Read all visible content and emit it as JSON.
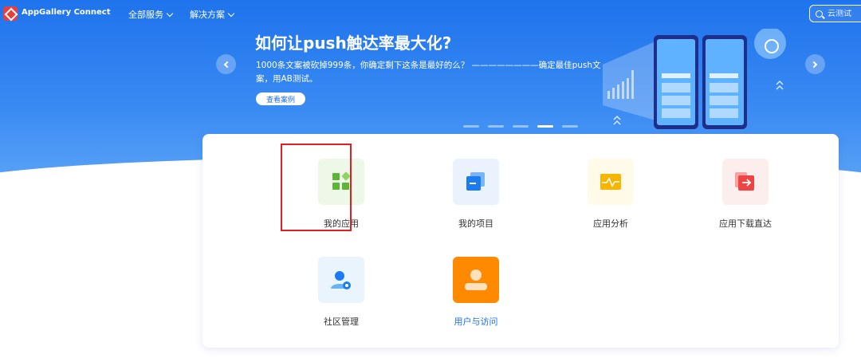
{
  "header": {
    "brand": "AppGallery Connect",
    "nav": [
      {
        "label": "全部服务"
      },
      {
        "label": "解决方案"
      }
    ],
    "search": {
      "placeholder": "云测试"
    }
  },
  "banner": {
    "title": "如何让push触达率最大化?",
    "description": "1000条文案被砍掉999条，你确定剩下这条是最好的么？ ————————确定最佳push文案，用AB测试。",
    "case_button": "查看案例",
    "carousel": {
      "total": 5,
      "active_index": 3
    }
  },
  "services": [
    {
      "label": "我的应用",
      "icon": "grid-apps-icon",
      "highlighted": true
    },
    {
      "label": "我的项目",
      "icon": "stack-pages-icon"
    },
    {
      "label": "应用分析",
      "icon": "pulse-chart-icon"
    },
    {
      "label": "应用下载直达",
      "icon": "download-arrow-icon"
    },
    {
      "label": "社区管理",
      "icon": "user-gear-icon"
    },
    {
      "label": "用户与访问",
      "icon": "user-profile-icon",
      "label_color": "#1f6fe8"
    }
  ],
  "colors": {
    "brand_red": "#e83e3e",
    "hero_blue": "#1f73ec",
    "highlight_red": "#e02020",
    "link_blue": "#1f6fe8"
  }
}
